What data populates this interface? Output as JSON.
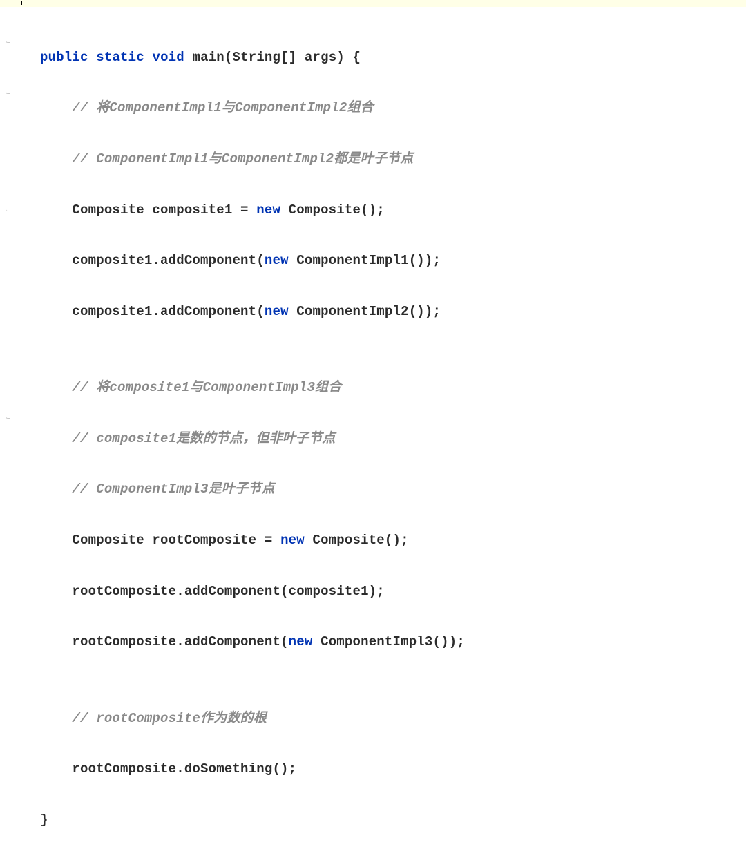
{
  "code": {
    "line1": {
      "kw1": "public",
      "sp1": " ",
      "kw2": "static",
      "sp2": " ",
      "kw3": "void",
      "sp3": " ",
      "sig": "main(String[] args) {"
    },
    "line2": "    // 将ComponentImpl1与ComponentImpl2组合",
    "line3": "    // ComponentImpl1与ComponentImpl2都是叶子节点",
    "line4_pre": "    Composite composite1 = ",
    "line4_kw": "new",
    "line4_post": " Composite();",
    "line5_pre": "    composite1.addComponent(",
    "line5_kw": "new",
    "line5_post": " ComponentImpl1());",
    "line6_pre": "    composite1.addComponent(",
    "line6_kw": "new",
    "line6_post": " ComponentImpl2());",
    "line7": "",
    "line8": "    // 将composite1与ComponentImpl3组合",
    "line9": "    // composite1是数的节点，但非叶子节点",
    "line10": "    // ComponentImpl3是叶子节点",
    "line11_pre": "    Composite rootComposite = ",
    "line11_kw": "new",
    "line11_post": " Composite();",
    "line12": "    rootComposite.addComponent(composite1);",
    "line13_pre": "    rootComposite.addComponent(",
    "line13_kw": "new",
    "line13_post": " ComponentImpl3());",
    "line14": "",
    "line15": "    // rootComposite作为数的根",
    "line16": "    rootComposite.doSomething();",
    "line17": "}"
  }
}
